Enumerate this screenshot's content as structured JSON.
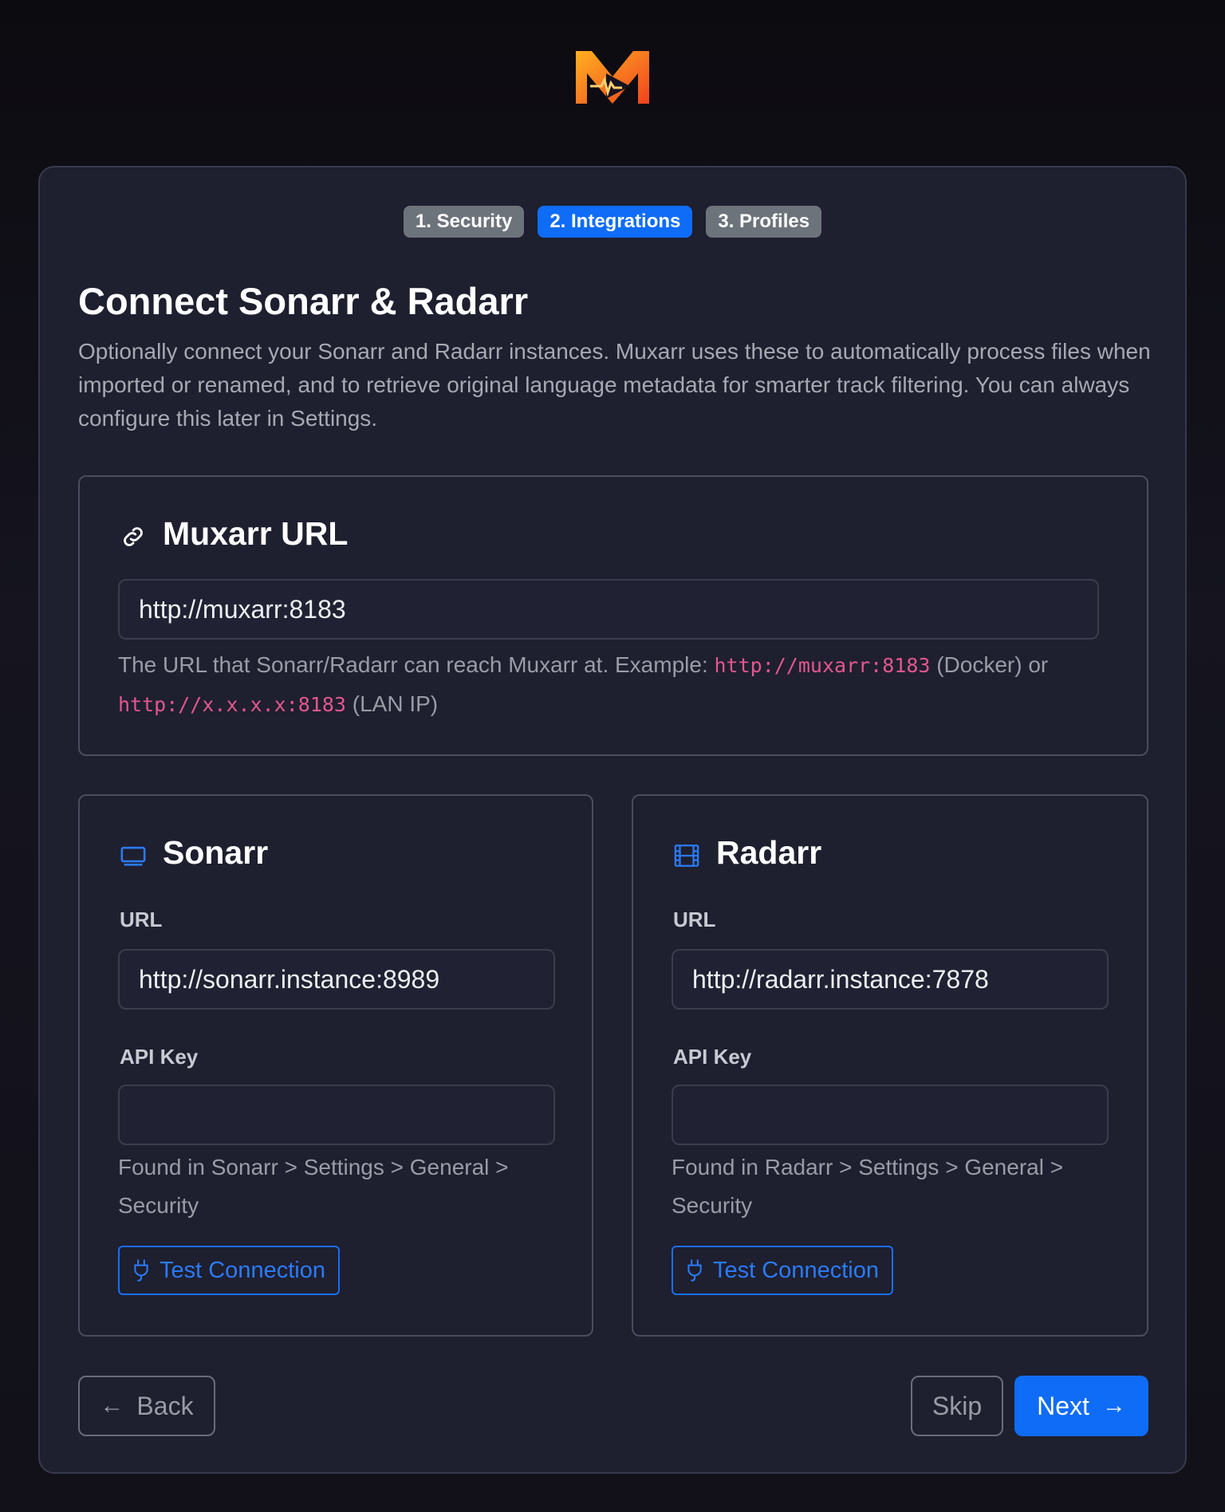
{
  "steps": [
    {
      "label": "1. Security"
    },
    {
      "label": "2. Integrations"
    },
    {
      "label": "3. Profiles"
    }
  ],
  "page": {
    "title": "Connect Sonarr & Radarr",
    "description": "Optionally connect your Sonarr and Radarr instances. Muxarr uses these to automatically process files when imported or renamed, and to retrieve original language metadata for smarter track filtering. You can always configure this later in Settings."
  },
  "muxarr": {
    "heading": "Muxarr URL",
    "icon": "link-icon",
    "value": "http://muxarr:8183",
    "help_prefix": "The URL that Sonarr/Radarr can reach Muxarr at. Example: ",
    "help_code1": "http://muxarr:8183",
    "help_mid": " (Docker) or",
    "help_code2": "http://x.x.x.x:8183",
    "help_suffix": " (LAN IP)"
  },
  "sonarr": {
    "heading": "Sonarr",
    "icon": "tv-icon",
    "url_label": "URL",
    "url_value": "http://sonarr.instance:8989",
    "api_label": "API Key",
    "api_value": "",
    "help": "Found in Sonarr > Settings > General > Security",
    "test_label": "Test Connection"
  },
  "radarr": {
    "heading": "Radarr",
    "icon": "film-icon",
    "url_label": "URL",
    "url_value": "http://radarr.instance:7878",
    "api_label": "API Key",
    "api_value": "",
    "help": "Found in Radarr > Settings > General > Security",
    "test_label": "Test Connection"
  },
  "footer": {
    "back_label": "Back",
    "skip_label": "Skip",
    "next_label": "Next"
  },
  "colors": {
    "accent": "#0f6cf6",
    "code": "#e3578f",
    "card_bg": "#1e1f2f"
  }
}
